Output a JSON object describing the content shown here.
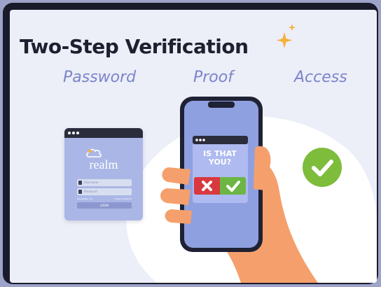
{
  "title": "Two-Step Verification",
  "steps": [
    "Password",
    "Proof",
    "Access"
  ],
  "login_window": {
    "brand": "realm",
    "fields": [
      "Username",
      "Password"
    ],
    "links": [
      "Remember me",
      "Forgot password"
    ],
    "button_label": "LOGIN"
  },
  "phone_card": {
    "prompt_line1": "IS THAT",
    "prompt_line2": "YOU?"
  },
  "colors": {
    "accent_purple": "#7b84c9",
    "deny_red": "#d8383e",
    "approve_green": "#6db544",
    "success_green": "#7ebc3b",
    "sparkle_gold": "#f3b23a"
  },
  "icons": [
    "sparkle-icon",
    "cloud-icon",
    "user-icon",
    "lock-icon",
    "deny-x-icon",
    "approve-check-icon",
    "success-check-icon"
  ]
}
